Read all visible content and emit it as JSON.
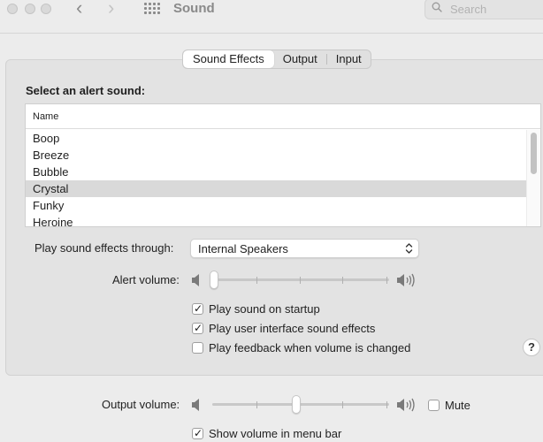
{
  "window": {
    "title": "Sound"
  },
  "search": {
    "placeholder": "Search"
  },
  "tabs": [
    {
      "label": "Sound Effects",
      "active": true
    },
    {
      "label": "Output",
      "active": false
    },
    {
      "label": "Input",
      "active": false
    }
  ],
  "alerts": {
    "heading": "Select an alert sound:",
    "column_header": "Name",
    "items": [
      "Boop",
      "Breeze",
      "Bubble",
      "Crystal",
      "Funky",
      "Heroine"
    ],
    "selected": "Crystal"
  },
  "play_through": {
    "label": "Play sound effects through:",
    "value": "Internal Speakers"
  },
  "alert_volume": {
    "label": "Alert volume:",
    "level": 0.0
  },
  "checkboxes": {
    "startup": {
      "label": "Play sound on startup",
      "checked": true
    },
    "ui_effects": {
      "label": "Play user interface sound effects",
      "checked": true
    },
    "feedback": {
      "label": "Play feedback when volume is changed",
      "checked": false
    }
  },
  "help": {
    "label": "?"
  },
  "output_volume": {
    "label": "Output volume:",
    "level": 0.5
  },
  "mute": {
    "label": "Mute",
    "checked": false
  },
  "menu_bar": {
    "label": "Show volume in menu bar",
    "checked": true
  },
  "colors": {
    "accent": "#1a1a1a",
    "selection": "#d9d9d9"
  }
}
